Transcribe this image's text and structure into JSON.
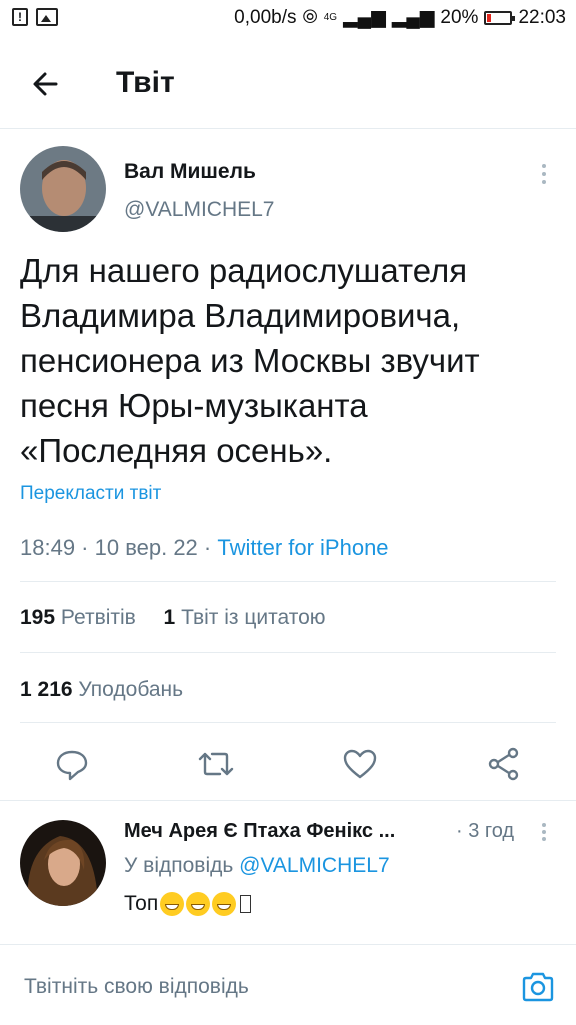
{
  "status_bar": {
    "net_speed": "0,00b/s",
    "network": "4G",
    "battery": "20%",
    "battery_level": 0.2,
    "time": "22:03"
  },
  "header": {
    "title": "Твіт",
    "back_icon": "arrow-left-icon"
  },
  "tweet": {
    "author_name": "Вал Мишель",
    "author_handle": "@VALMICHEL7",
    "text": "Для нашего радиослушателя Владимира Владимировича, пенсионера из Москвы звучит песня Юры-музыканта «Последняя осень».",
    "translate": "Перекласти твіт",
    "timestamp": "18:49 · 10 вер. 22 · ",
    "source": "Twitter for iPhone",
    "retweets_count": "195",
    "retweets_label": "Ретвітів",
    "quotes_count": "1",
    "quotes_label": "Твіт із цитатою",
    "likes_count": "1 216",
    "likes_label": "Уподобань"
  },
  "actions": [
    "reply-icon",
    "retweet-icon",
    "like-icon",
    "share-icon"
  ],
  "reply": {
    "author_name": "Меч Арея Є Птаха Фенікс ...",
    "time": "· 3 год",
    "reply_to_label": "У відповідь ",
    "reply_to_handle": "@VALMICHEL7",
    "text": "Топ"
  },
  "composer": {
    "placeholder": "Твітніть свою відповідь"
  },
  "colors": {
    "link": "#1b95e0",
    "muted": "#657786",
    "text": "#14171a"
  }
}
